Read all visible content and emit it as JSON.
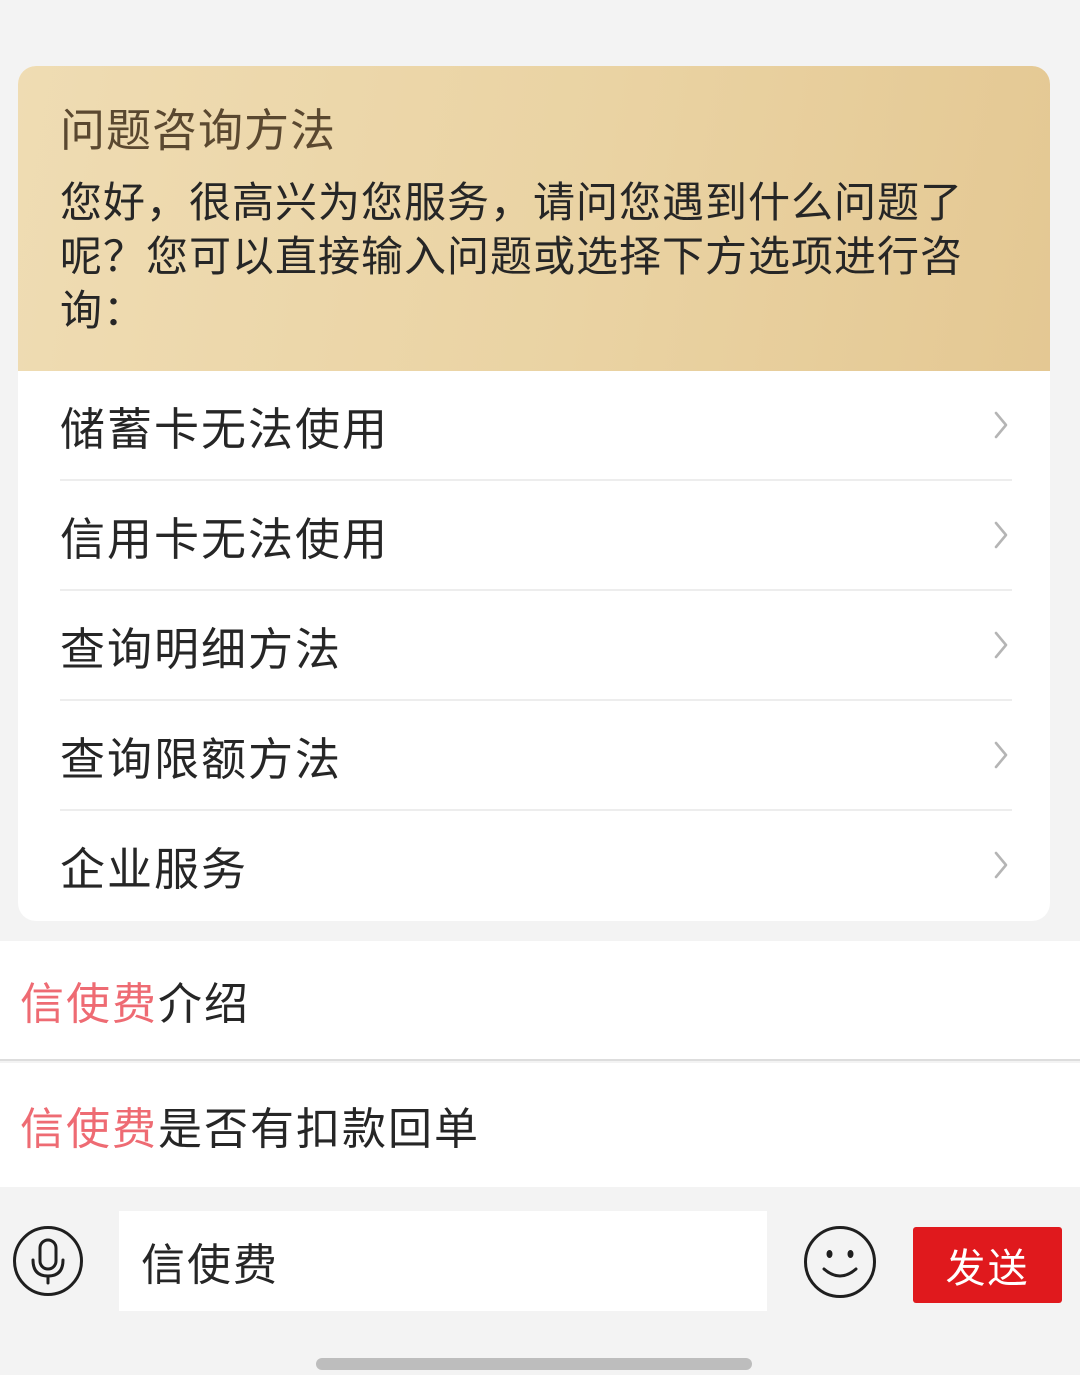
{
  "consult_card": {
    "title": "问题咨询方法",
    "description": "您好，很高兴为您服务，请问您遇到什么问题了呢？您可以直接输入问题或选择下方选项进行咨询：",
    "options": [
      {
        "label": "储蓄卡无法使用"
      },
      {
        "label": "信用卡无法使用"
      },
      {
        "label": "查询明细方法"
      },
      {
        "label": "查询限额方法"
      },
      {
        "label": "企业服务"
      }
    ]
  },
  "suggestions": [
    {
      "keyword": "信使费",
      "rest": "介绍"
    },
    {
      "keyword": "信使费",
      "rest": "是否有扣款回单"
    }
  ],
  "input_bar": {
    "input_value": "信使费",
    "send_label": "发送",
    "mic_icon": "microphone-icon",
    "emoji_icon": "smiley-icon"
  },
  "colors": {
    "header_gradient_start": "#efdcb3",
    "header_gradient_end": "#e4c893",
    "keyword_highlight": "#ee6b73",
    "send_button": "#e0191d"
  }
}
